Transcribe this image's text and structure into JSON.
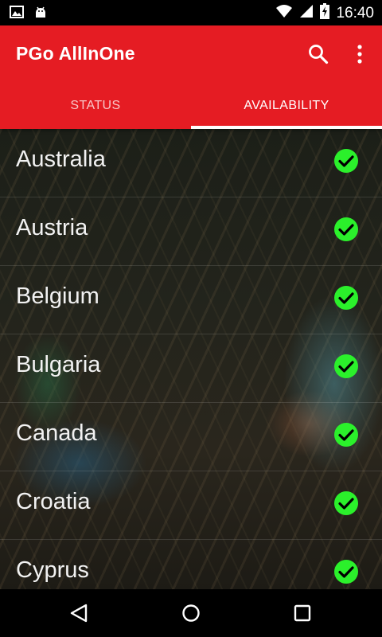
{
  "status_bar": {
    "time": "16:40",
    "icons": [
      "image-notification-icon",
      "android-notification-icon",
      "wifi-icon",
      "signal-icon",
      "battery-charging-icon"
    ]
  },
  "app_bar": {
    "title": "PGo AllInOne",
    "search_icon": "search-icon",
    "overflow_icon": "more-vert-icon"
  },
  "tabs": [
    {
      "label": "STATUS",
      "active": false
    },
    {
      "label": "AVAILABILITY",
      "active": true
    }
  ],
  "countries": [
    {
      "name": "Australia",
      "available": true
    },
    {
      "name": "Austria",
      "available": true
    },
    {
      "name": "Belgium",
      "available": true
    },
    {
      "name": "Bulgaria",
      "available": true
    },
    {
      "name": "Canada",
      "available": true
    },
    {
      "name": "Croatia",
      "available": true
    },
    {
      "name": "Cyprus",
      "available": true
    }
  ],
  "colors": {
    "app_bar": "#e51c23",
    "check_green": "#2bf02b"
  },
  "nav_bar": {
    "back_icon": "back-icon",
    "home_icon": "home-icon",
    "recents_icon": "recents-icon"
  }
}
